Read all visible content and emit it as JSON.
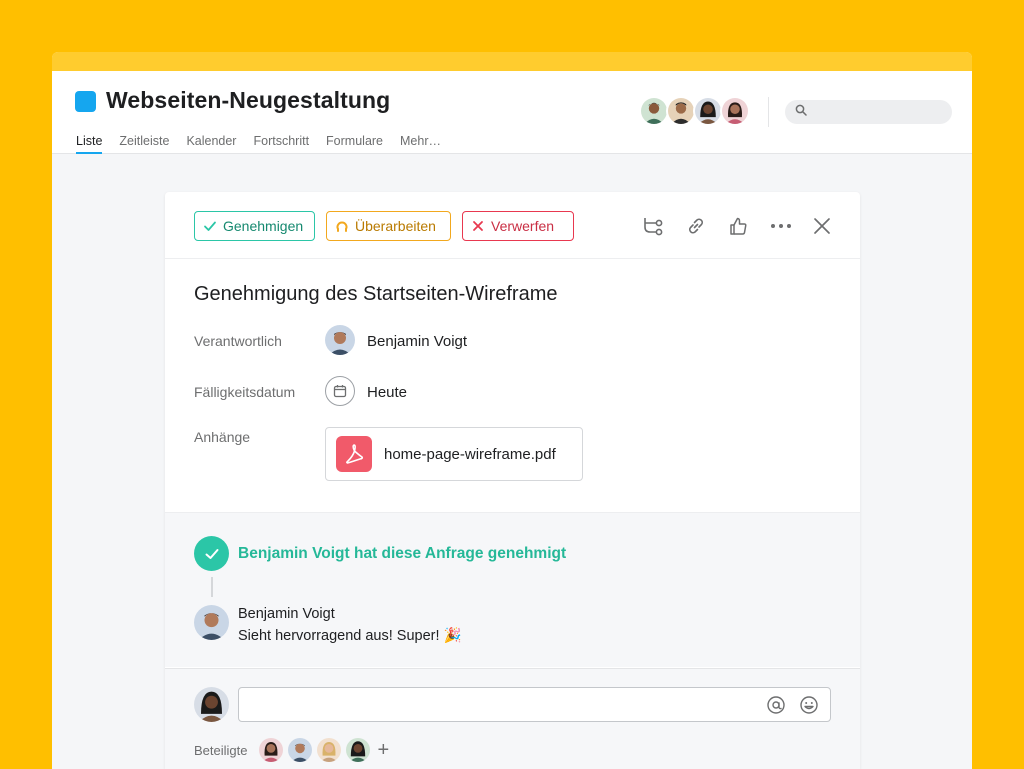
{
  "project": {
    "title": "Webseiten-Neugestaltung",
    "color": "#15A6EF",
    "tabs": [
      {
        "label": "Liste",
        "active": true
      },
      {
        "label": "Zeitleiste",
        "active": false
      },
      {
        "label": "Kalender",
        "active": false
      },
      {
        "label": "Fortschritt",
        "active": false
      },
      {
        "label": "Formulare",
        "active": false
      },
      {
        "label": "Mehr…",
        "active": false
      }
    ],
    "search": {
      "value": "",
      "placeholder": ""
    }
  },
  "task": {
    "actions": {
      "approve_label": "Genehmigen",
      "revise_label": "Überarbeiten",
      "reject_label": "Verwerfen"
    },
    "title": "Genehmigung des Startseiten-Wireframe",
    "fields": {
      "assignee_label": "Verantwortlich",
      "assignee_value": "Benjamin Voigt",
      "due_label": "Fälligkeitsdatum",
      "due_value": "Heute",
      "attachments_label": "Anhänge",
      "attachment_name": "home-page-wireframe.pdf"
    }
  },
  "activity": {
    "approval_text": "Benjamin Voigt hat diese Anfrage genehmigt",
    "comment": {
      "author": "Benjamin Voigt",
      "text": "Sieht hervorragend aus! Super! 🎉"
    }
  },
  "composer": {
    "value": "",
    "placeholder": "",
    "participants_label": "Beteiligte",
    "add_symbol": "+"
  },
  "colors": {
    "background": "#FFBF00",
    "approve": "#2BC6A7",
    "revise": "#F2A81E",
    "reject": "#E8384F",
    "pdf": "#F15A6A"
  }
}
